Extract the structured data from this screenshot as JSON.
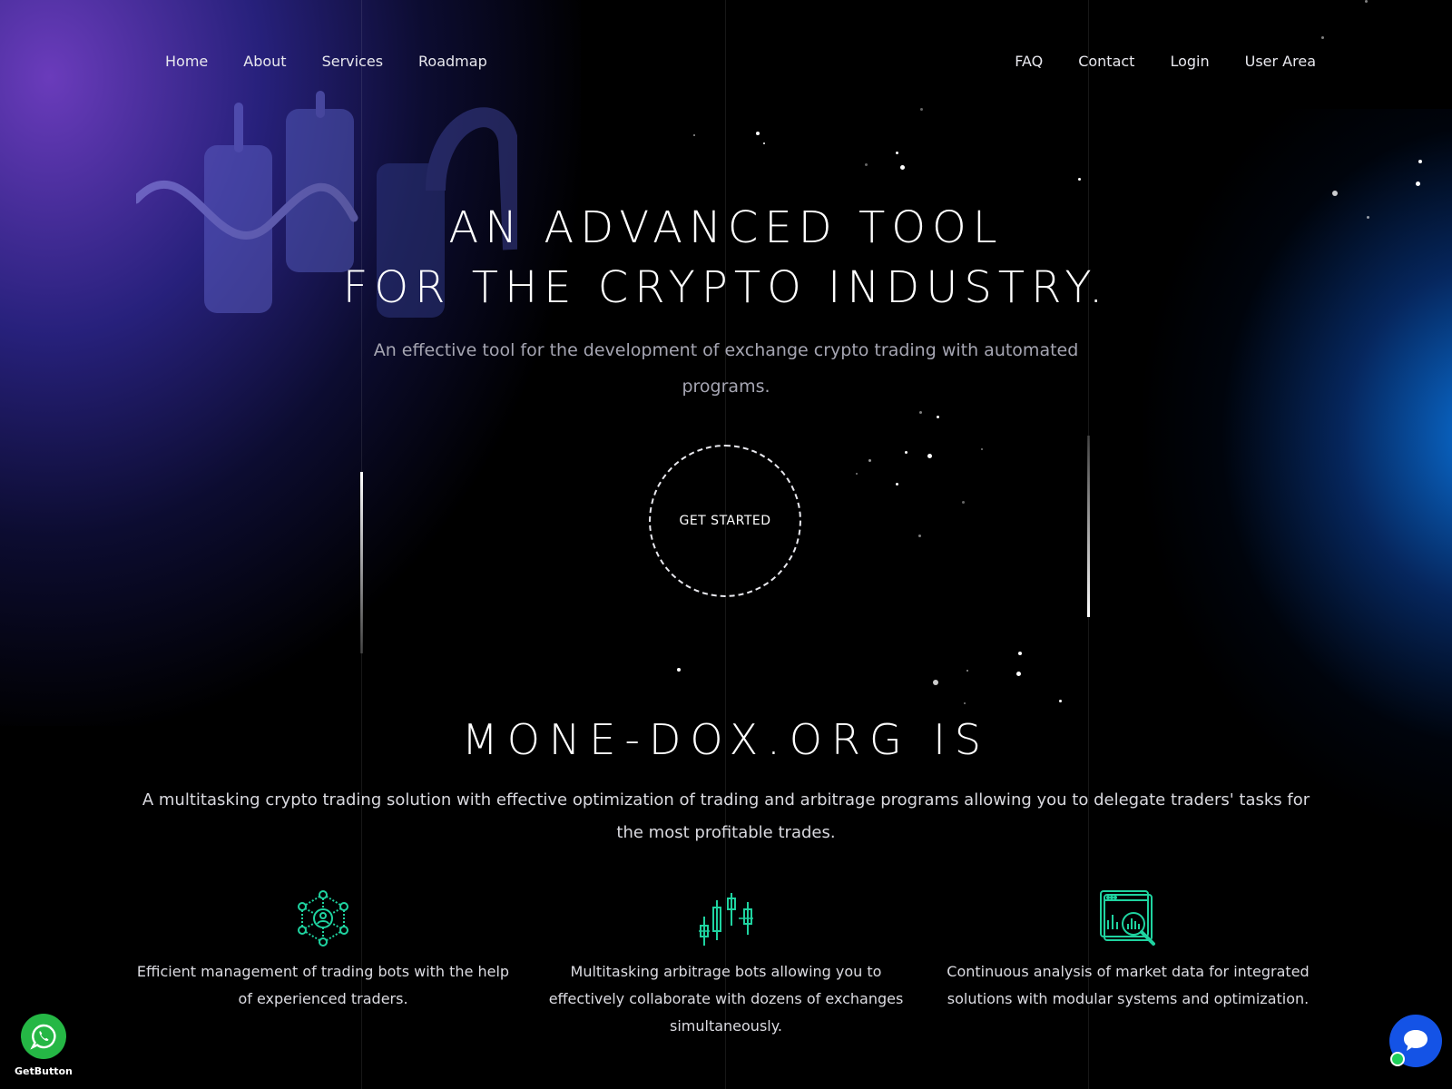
{
  "nav": {
    "left": [
      "Home",
      "About",
      "Services",
      "Roadmap"
    ],
    "right": [
      "FAQ",
      "Contact",
      "Login",
      "User Area"
    ]
  },
  "hero": {
    "title_line1": "AN ADVANCED TOOL",
    "title_line2": "FOR THE CRYPTO INDUSTRY.",
    "subtitle": "An effective tool for the development of exchange crypto trading with automated programs.",
    "cta_label": "GET STARTED"
  },
  "about": {
    "title": "MONE-DOX.ORG IS",
    "description": "A multitasking crypto trading solution with effective optimization of trading and arbitrage programs allowing you to delegate traders' tasks for the most profitable trades."
  },
  "features": [
    {
      "icon": "network-icon",
      "text": "Efficient management of trading bots with the help of experienced traders."
    },
    {
      "icon": "candlestick-chart-icon",
      "text": "Multitasking arbitrage bots allowing you to effectively collaborate with dozens of exchanges simultaneously."
    },
    {
      "icon": "market-analysis-icon",
      "text": "Continuous analysis of market data for integrated solutions with modular systems and optimization."
    }
  ],
  "widgets": {
    "whatsapp_icon": "whatsapp-icon",
    "getbutton_label": "GetButton",
    "chat_icon": "chat-bubble-icon"
  },
  "colors": {
    "accent_green": "#1fd3a0",
    "whatsapp_green": "#25b745",
    "chat_blue": "#1453e6",
    "background": "#000000"
  }
}
